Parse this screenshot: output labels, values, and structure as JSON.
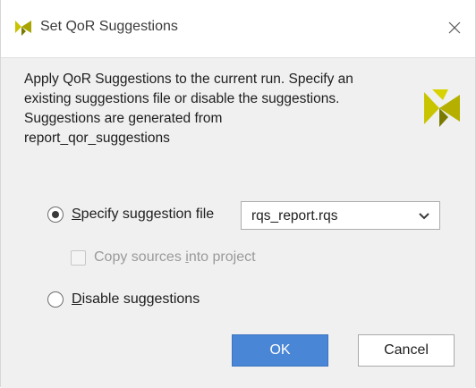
{
  "window": {
    "title": "Set QoR Suggestions",
    "close_icon": "close-icon",
    "app_icon": "vivado-logo-icon"
  },
  "description": {
    "lines": [
      "Apply QoR Suggestions to the current run. Specify an",
      "existing suggestions file or disable the suggestions.",
      "Suggestions are generated from",
      "report_qor_suggestions"
    ]
  },
  "options": {
    "specify": {
      "label_mnemonic": "S",
      "label_rest": "pecify suggestion file",
      "checked": true
    },
    "file_select": {
      "value": "rqs_report.rqs"
    },
    "copy_sources": {
      "label_before": "Copy sources ",
      "label_mnemonic": "i",
      "label_after": "nto project",
      "checked": false,
      "enabled": false
    },
    "disable": {
      "label_mnemonic": "D",
      "label_rest": "isable suggestions",
      "checked": false
    }
  },
  "buttons": {
    "ok": "OK",
    "cancel": "Cancel"
  },
  "colors": {
    "accent": "#4a86d6",
    "logo_yellow": "#c9c400",
    "logo_dark": "#7b7a00"
  }
}
